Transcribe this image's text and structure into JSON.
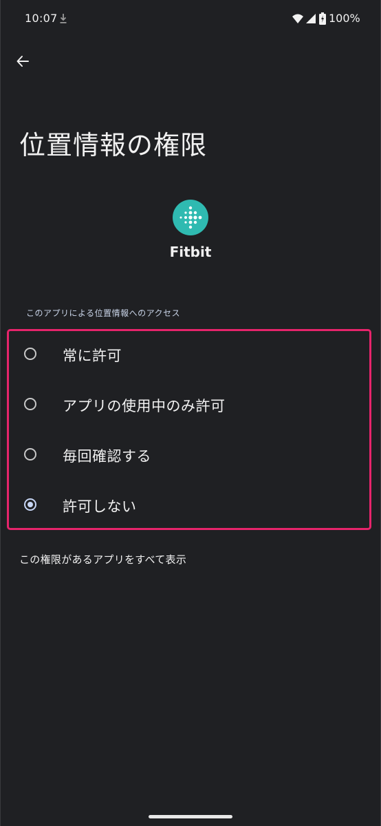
{
  "status_bar": {
    "time": "10:07",
    "battery": "100%",
    "icons": [
      "download-icon",
      "wifi-icon",
      "signal-icon",
      "battery-icon"
    ]
  },
  "header": {
    "back_icon": "arrow-left-icon",
    "title": "位置情報の権限"
  },
  "app": {
    "icon": "fitbit-logo-icon",
    "name": "Fitbit",
    "icon_color": "#2fbab1"
  },
  "section": {
    "label": "このアプリによる位置情報へのアクセス"
  },
  "options": [
    {
      "label": "常に許可",
      "selected": false
    },
    {
      "label": "アプリの使用中のみ許可",
      "selected": false
    },
    {
      "label": "毎回確認する",
      "selected": false
    },
    {
      "label": "許可しない",
      "selected": true
    }
  ],
  "footer": {
    "show_all_label": "この権限があるアプリをすべて表示"
  },
  "colors": {
    "background": "#1f2023",
    "highlight_border": "#e6246b",
    "radio_selected": "#c7d6f5"
  }
}
